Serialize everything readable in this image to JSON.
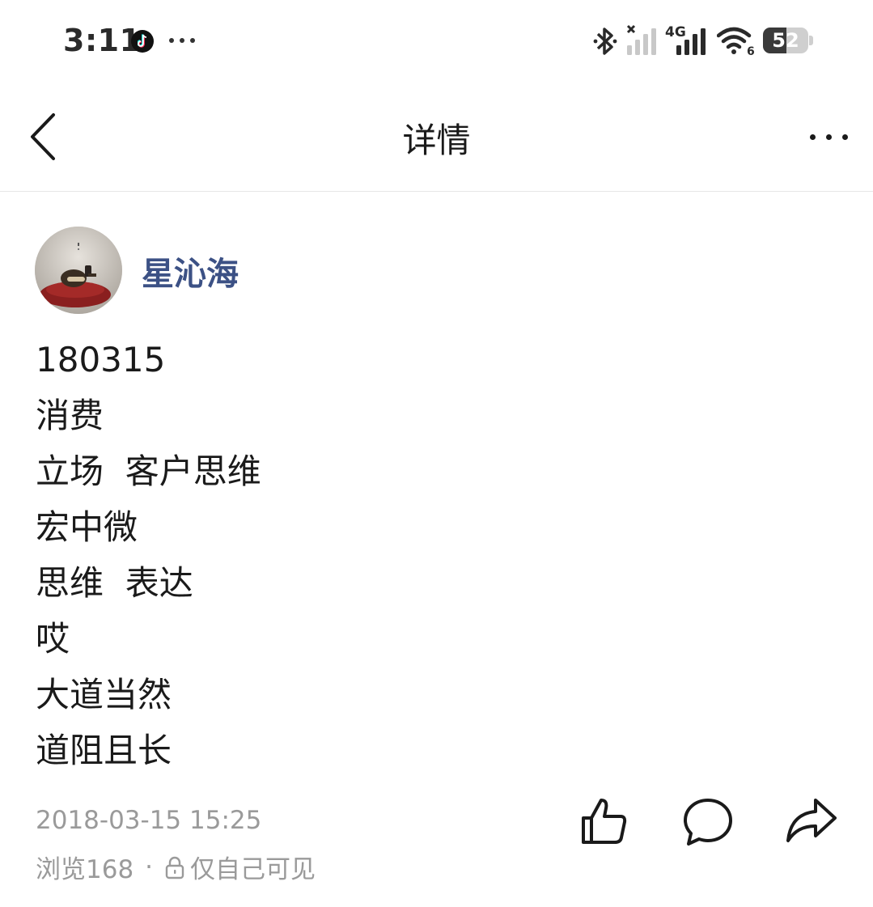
{
  "status_bar": {
    "time": "3:11",
    "battery": "52",
    "battery_level": 0.52,
    "network": "4G",
    "wifi_badge": "6"
  },
  "header": {
    "title": "详情"
  },
  "post": {
    "author": "星沁海",
    "lines": [
      "180315",
      "消费",
      "立场  客户思维",
      "宏中微",
      "思维  表达",
      "哎",
      "大道当然",
      "道阻且长"
    ],
    "timestamp": "2018-03-15 15:25",
    "views": "浏览168",
    "separator": "·",
    "visibility": "仅自己可见"
  },
  "icons": [
    "back-icon",
    "more-icon",
    "like-icon",
    "comment-icon",
    "share-icon",
    "lock-icon",
    "bluetooth-icon",
    "signal-icon",
    "wifi-icon",
    "battery-icon",
    "tiktok-icon"
  ]
}
